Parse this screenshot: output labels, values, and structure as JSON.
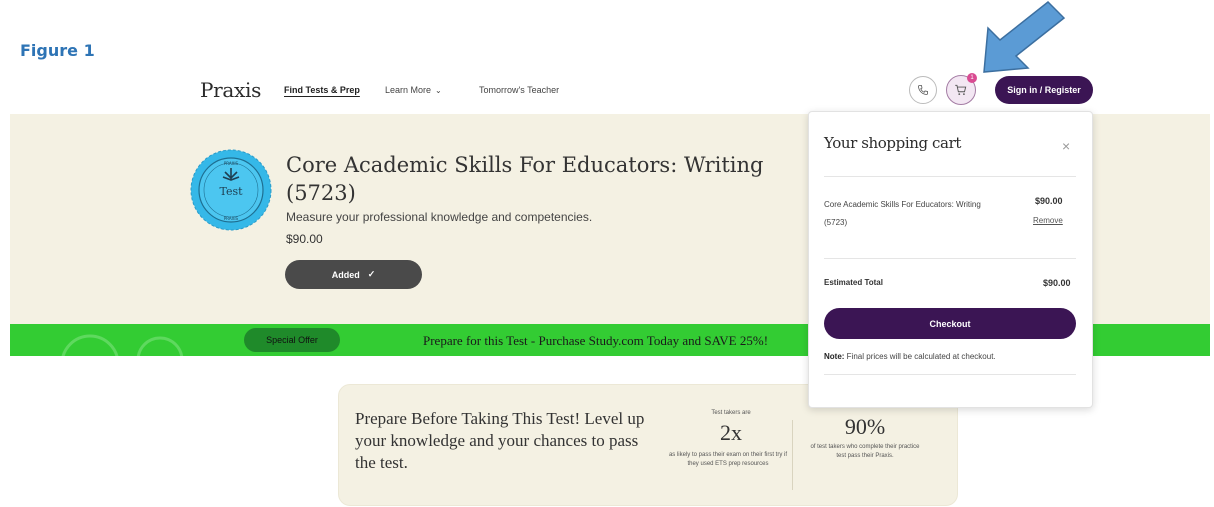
{
  "figure_label": "Figure 1",
  "header": {
    "logo": "Praxis",
    "nav": [
      {
        "label": "Find Tests & Prep"
      },
      {
        "label": "Learn More"
      },
      {
        "label": "Tomorrow's Teacher"
      }
    ],
    "cart_count": "1",
    "signin_label": "Sign in / Register",
    "icons": [
      "phone-icon",
      "cart-icon",
      "chevron-down-icon"
    ]
  },
  "product": {
    "badge_text": "Test",
    "badge_ring_text": "PRAXIS",
    "title": "Core Academic Skills For Educators: Writing (5723)",
    "description": "Measure your professional knowledge and competencies.",
    "price": "$90.00",
    "added_label": "Added",
    "check_icon": "✓"
  },
  "promo": {
    "badge": "Special Offer",
    "text": "Prepare for this Test - Purchase Study.com Today and SAVE 25%!"
  },
  "prepare": {
    "title": "Prepare Before Taking This Test! Level up your knowledge and your chances to pass the test.",
    "stat1_top": "Test takers are",
    "stat1_value": "2x",
    "stat1_text": "as likely to pass their exam on their first try if they used ETS prep resources",
    "stat2_value": "90%",
    "stat2_text": "of test takers who complete their practice test pass their Praxis."
  },
  "cart": {
    "title": "Your shopping cart",
    "close": "×",
    "item_name": "Core Academic Skills For Educators: Writing (5723)",
    "item_price": "$90.00",
    "remove_label": "Remove",
    "total_label": "Estimated Total",
    "total_value": "$90.00",
    "checkout_label": "Checkout",
    "note_bold": "Note:",
    "note_text": " Final prices will be calculated at checkout."
  },
  "colors": {
    "brand_purple": "#3b1554",
    "hero_bg": "#f4f1e3",
    "promo_green": "#33cc33",
    "figure_blue": "#2e74b5",
    "arrow_blue": "#5b9bd5"
  }
}
